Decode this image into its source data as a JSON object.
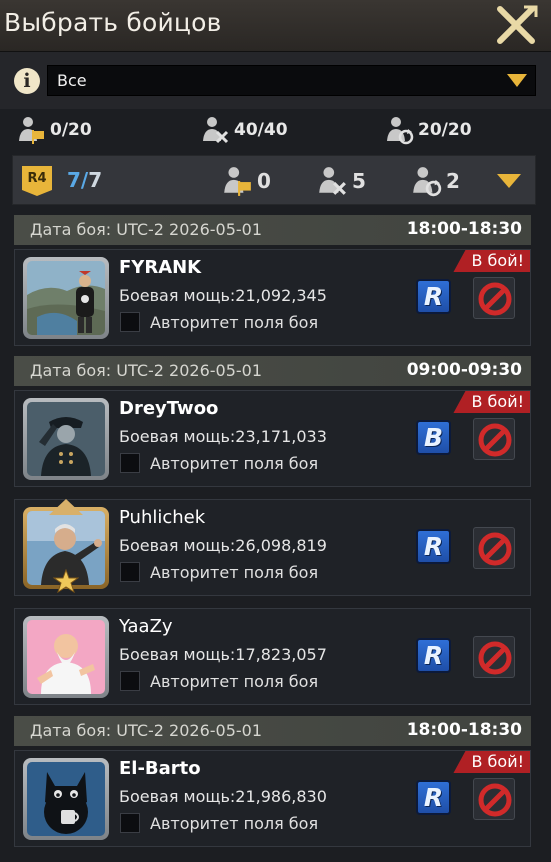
{
  "header": {
    "title": "Выбрать бойцов",
    "close_icon": "close-x-icon"
  },
  "filter": {
    "info_icon_glyph": "i",
    "selected": "Все"
  },
  "stats": [
    {
      "icon": "soldier-flag-icon",
      "value": "0/20"
    },
    {
      "icon": "soldier-cross-icon",
      "value": "40/40"
    },
    {
      "icon": "soldier-refresh-icon",
      "value": "20/20"
    }
  ],
  "summary": {
    "rank_badge": "R4",
    "selected": "7",
    "total": "7",
    "flag_count": "0",
    "cross_count": "5",
    "refresh_count": "2"
  },
  "sections": [
    {
      "date": "Дата боя: UTC-2 2026-05-01",
      "time": "18:00-18:30"
    },
    {
      "date": "Дата боя: UTC-2 2026-05-01",
      "time": "09:00-09:30"
    },
    {
      "date": "Дата боя: UTC-2 2026-05-01",
      "time": "18:00-18:30"
    }
  ],
  "players": [
    {
      "name": "FYRANK",
      "power": "Боевая мощь:21,092,345",
      "authority": "Авторитет поля боя",
      "role": "R",
      "tag": "В бой!"
    },
    {
      "name": "DreyTwoo",
      "power": "Боевая мощь:23,171,033",
      "authority": "Авторитет поля боя",
      "role": "B",
      "tag": "В бой!"
    },
    {
      "name": "Puhlichek",
      "power": "Боевая мощь:26,098,819",
      "authority": "Авторитет поля боя",
      "role": "R",
      "tag": ""
    },
    {
      "name": "YaaZy",
      "power": "Боевая мощь:17,823,057",
      "authority": "Авторитет поля боя",
      "role": "R",
      "tag": ""
    },
    {
      "name": "El-Barto",
      "power": "Боевая мощь:21,986,830",
      "authority": "Авторитет поля боя",
      "role": "R",
      "tag": "В бой!"
    }
  ],
  "colors": {
    "accent_gold": "#e8b53a",
    "stat_blue": "#5aa9e6",
    "battle_tag_red": "#b02024",
    "ban_red": "#d12a2a"
  }
}
